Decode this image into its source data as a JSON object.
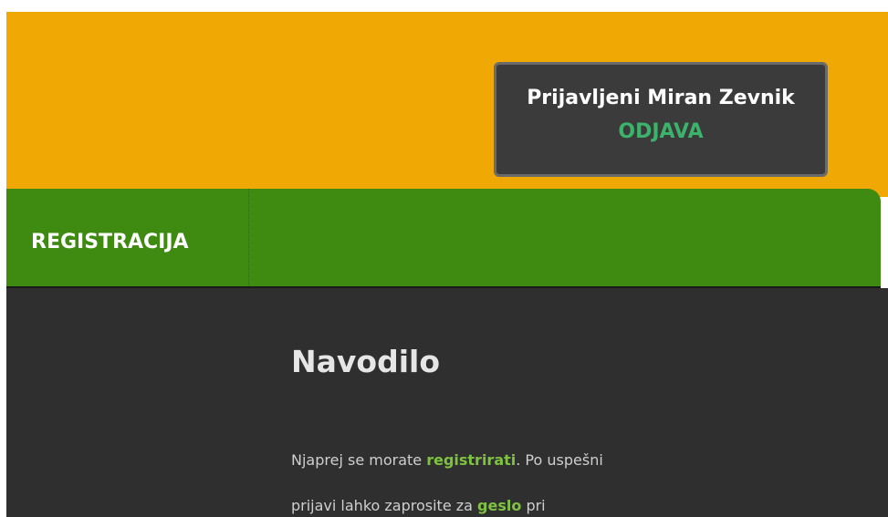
{
  "header": {
    "user_label": "Prijavljeni Miran Zevnik",
    "logout_label": "ODJAVA"
  },
  "nav": {
    "items": [
      {
        "label": "REGISTRACIJA"
      }
    ]
  },
  "content": {
    "title": "Navodilo",
    "paragraph": {
      "part1": "Njaprej se morate ",
      "link1": "registrirati",
      "part2": ". Po uspešni",
      "part3": "prijavi lahko zaprosite za ",
      "link2": "geslo",
      "part4": " pri"
    }
  },
  "colors": {
    "header_bg": "#f0a904",
    "nav_bg": "#3f8a10",
    "content_bg": "#2f2f2f",
    "accent_link": "#7fc242",
    "logout": "#3bb36a"
  }
}
